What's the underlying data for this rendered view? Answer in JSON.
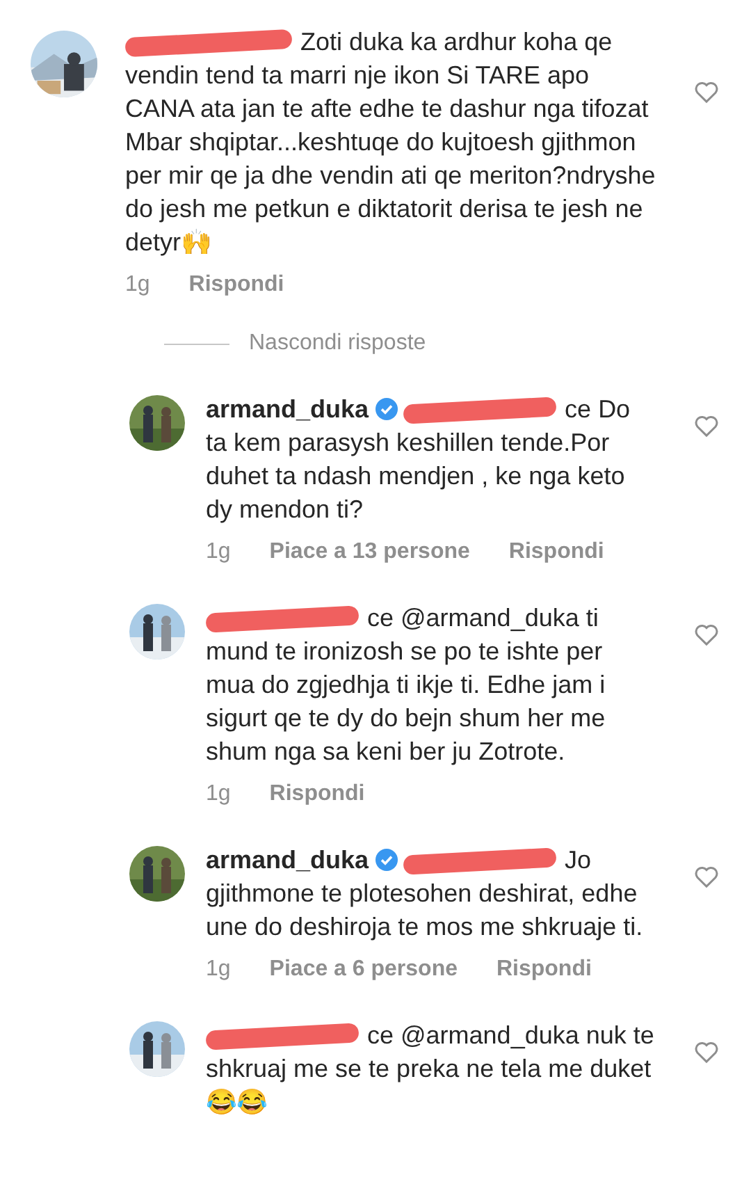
{
  "comments": [
    {
      "redacted": true,
      "text": "Zoti duka ka ardhur koha qe vendin tend ta marri nje ikon Si TARE apo CANA ata jan te afte edhe te dashur nga tifozat Mbar shqiptar...keshtuqe do kujtoesh gjithmon per mir qe ja dhe vendin ati qe meriton?ndryshe do jesh me petkun e diktatorit derisa te jesh ne detyr🙌",
      "time": "1g",
      "reply": "Rispondi",
      "liked": false,
      "hide_replies": "Nascondi risposte",
      "children": [
        {
          "redacted": true,
          "username": "armand_duka",
          "verified": true,
          "mention_tail": "ce",
          "text": "Do ta kem parasysh keshillen tende.Por duhet ta ndash  mendjen , ke nga keto dy mendon ti?",
          "time": "1g",
          "likes": "Piace a 13 persone",
          "reply": "Rispondi",
          "liked": false
        },
        {
          "redacted": true,
          "mention_tail": "ce",
          "text": "@armand_duka ti mund te ironizosh se po te ishte per mua do zgjedhja ti ikje ti. Edhe jam i sigurt qe te dy do bejn shum her me shum nga sa keni ber ju Zotrote.",
          "time": "1g",
          "reply": "Rispondi",
          "liked": false
        },
        {
          "redacted": true,
          "username": "armand_duka",
          "verified": true,
          "text": "Jo gjithmone te plotesohen deshirat, edhe une do deshiroja te mos me shkruaje ti.",
          "time": "1g",
          "likes": "Piace a 6 persone",
          "reply": "Rispondi",
          "liked": false
        },
        {
          "redacted": true,
          "mention_tail": "ce",
          "text": "@armand_duka nuk te shkruaj me se te preka ne tela me duket😂😂",
          "liked": false
        }
      ]
    }
  ]
}
